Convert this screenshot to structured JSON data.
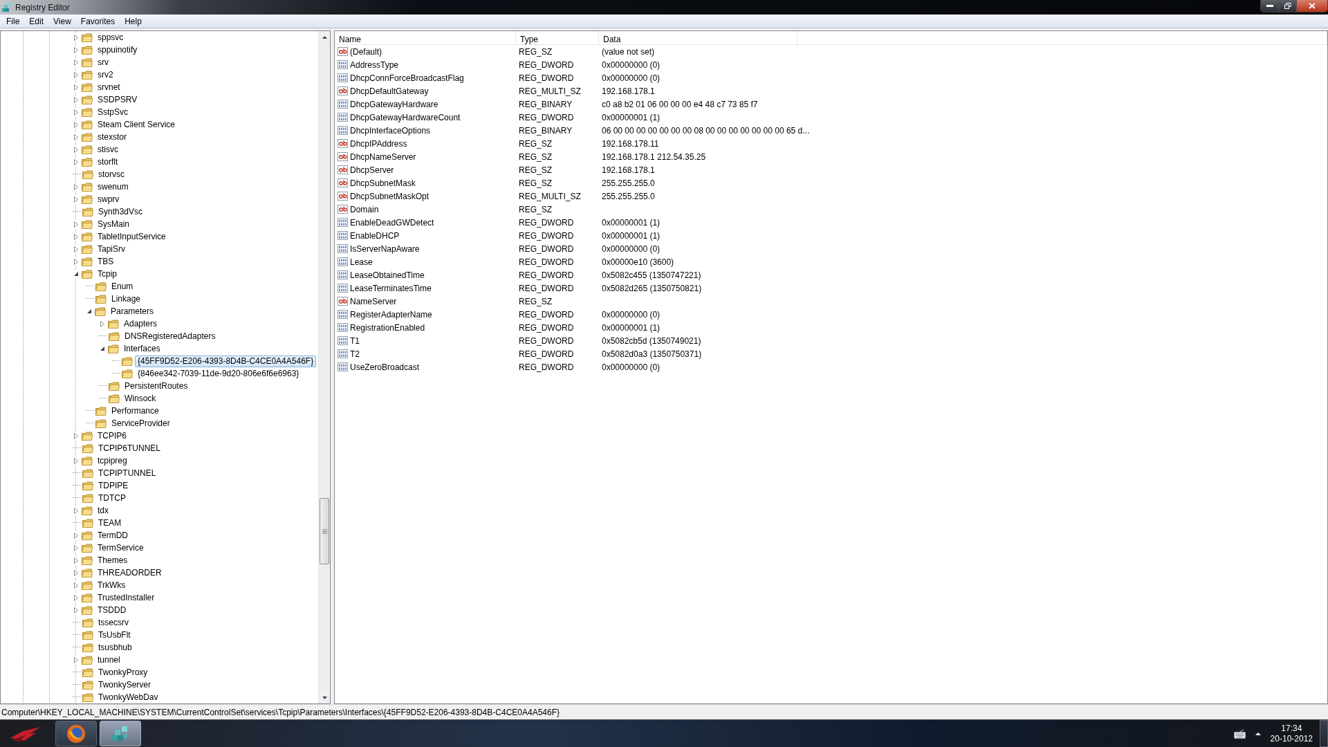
{
  "window": {
    "title": "Registry Editor"
  },
  "menu": [
    "File",
    "Edit",
    "View",
    "Favorites",
    "Help"
  ],
  "tree": [
    {
      "label": "sppsvc",
      "expandable": true,
      "expanded": false,
      "selected": false
    },
    {
      "label": "sppuinotify",
      "expandable": true,
      "expanded": false,
      "selected": false
    },
    {
      "label": "srv",
      "expandable": true,
      "expanded": false,
      "selected": false
    },
    {
      "label": "srv2",
      "expandable": true,
      "expanded": false,
      "selected": false
    },
    {
      "label": "srvnet",
      "expandable": true,
      "expanded": false,
      "selected": false
    },
    {
      "label": "SSDPSRV",
      "expandable": true,
      "expanded": false,
      "selected": false
    },
    {
      "label": "SstpSvc",
      "expandable": true,
      "expanded": false,
      "selected": false
    },
    {
      "label": "Steam Client Service",
      "expandable": true,
      "expanded": false,
      "selected": false
    },
    {
      "label": "stexstor",
      "expandable": true,
      "expanded": false,
      "selected": false
    },
    {
      "label": "stisvc",
      "expandable": true,
      "expanded": false,
      "selected": false
    },
    {
      "label": "storflt",
      "expandable": true,
      "expanded": false,
      "selected": false
    },
    {
      "label": "storvsc",
      "expandable": false,
      "selected": false
    },
    {
      "label": "swenum",
      "expandable": true,
      "expanded": false,
      "selected": false
    },
    {
      "label": "swprv",
      "expandable": true,
      "expanded": false,
      "selected": false
    },
    {
      "label": "Synth3dVsc",
      "expandable": false,
      "selected": false
    },
    {
      "label": "SysMain",
      "expandable": true,
      "expanded": false,
      "selected": false
    },
    {
      "label": "TabletInputService",
      "expandable": true,
      "expanded": false,
      "selected": false
    },
    {
      "label": "TapiSrv",
      "expandable": true,
      "expanded": false,
      "selected": false
    },
    {
      "label": "TBS",
      "expandable": true,
      "expanded": false,
      "selected": false
    },
    {
      "label": "Tcpip",
      "expandable": true,
      "expanded": true,
      "selected": false,
      "children": [
        {
          "label": "Enum",
          "expandable": false,
          "selected": false
        },
        {
          "label": "Linkage",
          "expandable": false,
          "selected": false
        },
        {
          "label": "Parameters",
          "expandable": true,
          "expanded": true,
          "selected": false,
          "children": [
            {
              "label": "Adapters",
              "expandable": true,
              "expanded": false,
              "selected": false
            },
            {
              "label": "DNSRegisteredAdapters",
              "expandable": false,
              "selected": false
            },
            {
              "label": "Interfaces",
              "expandable": true,
              "expanded": true,
              "selected": false,
              "children": [
                {
                  "label": "{45FF9D52-E206-4393-8D4B-C4CE0A4A546F}",
                  "expandable": false,
                  "selected": true
                },
                {
                  "label": "{846ee342-7039-11de-9d20-806e6f6e6963}",
                  "expandable": false,
                  "selected": false
                }
              ]
            },
            {
              "label": "PersistentRoutes",
              "expandable": false,
              "selected": false
            },
            {
              "label": "Winsock",
              "expandable": false,
              "selected": false
            }
          ]
        },
        {
          "label": "Performance",
          "expandable": false,
          "selected": false
        },
        {
          "label": "ServiceProvider",
          "expandable": false,
          "selected": false
        }
      ]
    },
    {
      "label": "TCPIP6",
      "expandable": true,
      "expanded": false,
      "selected": false
    },
    {
      "label": "TCPIP6TUNNEL",
      "expandable": false,
      "selected": false
    },
    {
      "label": "tcpipreg",
      "expandable": true,
      "expanded": false,
      "selected": false
    },
    {
      "label": "TCPIPTUNNEL",
      "expandable": false,
      "selected": false
    },
    {
      "label": "TDPIPE",
      "expandable": false,
      "selected": false
    },
    {
      "label": "TDTCP",
      "expandable": false,
      "selected": false
    },
    {
      "label": "tdx",
      "expandable": true,
      "expanded": false,
      "selected": false
    },
    {
      "label": "TEAM",
      "expandable": false,
      "selected": false
    },
    {
      "label": "TermDD",
      "expandable": true,
      "expanded": false,
      "selected": false
    },
    {
      "label": "TermService",
      "expandable": true,
      "expanded": false,
      "selected": false
    },
    {
      "label": "Themes",
      "expandable": true,
      "expanded": false,
      "selected": false
    },
    {
      "label": "THREADORDER",
      "expandable": true,
      "expanded": false,
      "selected": false
    },
    {
      "label": "TrkWks",
      "expandable": true,
      "expanded": false,
      "selected": false
    },
    {
      "label": "TrustedInstaller",
      "expandable": true,
      "expanded": false,
      "selected": false
    },
    {
      "label": "TSDDD",
      "expandable": true,
      "expanded": false,
      "selected": false
    },
    {
      "label": "tssecsrv",
      "expandable": false,
      "selected": false
    },
    {
      "label": "TsUsbFlt",
      "expandable": false,
      "selected": false
    },
    {
      "label": "tsusbhub",
      "expandable": false,
      "selected": false
    },
    {
      "label": "tunnel",
      "expandable": true,
      "expanded": false,
      "selected": false
    },
    {
      "label": "TwonkyProxy",
      "expandable": false,
      "selected": false
    },
    {
      "label": "TwonkyServer",
      "expandable": false,
      "selected": false
    },
    {
      "label": "TwonkyWebDav",
      "expandable": false,
      "selected": false
    }
  ],
  "values": {
    "columns": [
      "Name",
      "Type",
      "Data"
    ],
    "rows": [
      {
        "kind": "string",
        "name": "(Default)",
        "type": "REG_SZ",
        "data": "(value not set)"
      },
      {
        "kind": "binary",
        "name": "AddressType",
        "type": "REG_DWORD",
        "data": "0x00000000 (0)"
      },
      {
        "kind": "binary",
        "name": "DhcpConnForceBroadcastFlag",
        "type": "REG_DWORD",
        "data": "0x00000000 (0)"
      },
      {
        "kind": "string",
        "name": "DhcpDefaultGateway",
        "type": "REG_MULTI_SZ",
        "data": "192.168.178.1"
      },
      {
        "kind": "binary",
        "name": "DhcpGatewayHardware",
        "type": "REG_BINARY",
        "data": "c0 a8 b2 01 06 00 00 00 e4 48 c7 73 85 f7"
      },
      {
        "kind": "binary",
        "name": "DhcpGatewayHardwareCount",
        "type": "REG_DWORD",
        "data": "0x00000001 (1)"
      },
      {
        "kind": "binary",
        "name": "DhcpInterfaceOptions",
        "type": "REG_BINARY",
        "data": "06 00 00 00 00 00 00 00 08 00 00 00 00 00 00 00 65 d..."
      },
      {
        "kind": "string",
        "name": "DhcpIPAddress",
        "type": "REG_SZ",
        "data": "192.168.178.11"
      },
      {
        "kind": "string",
        "name": "DhcpNameServer",
        "type": "REG_SZ",
        "data": "192.168.178.1 212.54.35.25"
      },
      {
        "kind": "string",
        "name": "DhcpServer",
        "type": "REG_SZ",
        "data": "192.168.178.1"
      },
      {
        "kind": "string",
        "name": "DhcpSubnetMask",
        "type": "REG_SZ",
        "data": "255.255.255.0"
      },
      {
        "kind": "string",
        "name": "DhcpSubnetMaskOpt",
        "type": "REG_MULTI_SZ",
        "data": "255.255.255.0"
      },
      {
        "kind": "string",
        "name": "Domain",
        "type": "REG_SZ"
      },
      {
        "kind": "binary",
        "name": "EnableDeadGWDetect",
        "type": "REG_DWORD",
        "data": "0x00000001 (1)"
      },
      {
        "kind": "binary",
        "name": "EnableDHCP",
        "type": "REG_DWORD",
        "data": "0x00000001 (1)"
      },
      {
        "kind": "binary",
        "name": "IsServerNapAware",
        "type": "REG_DWORD",
        "data": "0x00000000 (0)"
      },
      {
        "kind": "binary",
        "name": "Lease",
        "type": "REG_DWORD",
        "data": "0x00000e10 (3600)"
      },
      {
        "kind": "binary",
        "name": "LeaseObtainedTime",
        "type": "REG_DWORD",
        "data": "0x5082c455 (1350747221)"
      },
      {
        "kind": "binary",
        "name": "LeaseTerminatesTime",
        "type": "REG_DWORD",
        "data": "0x5082d265 (1350750821)"
      },
      {
        "kind": "string",
        "name": "NameServer",
        "type": "REG_SZ"
      },
      {
        "kind": "binary",
        "name": "RegisterAdapterName",
        "type": "REG_DWORD",
        "data": "0x00000000 (0)"
      },
      {
        "kind": "binary",
        "name": "RegistrationEnabled",
        "type": "REG_DWORD",
        "data": "0x00000001 (1)"
      },
      {
        "kind": "binary",
        "name": "T1",
        "type": "REG_DWORD",
        "data": "0x5082cb5d (1350749021)"
      },
      {
        "kind": "binary",
        "name": "T2",
        "type": "REG_DWORD",
        "data": "0x5082d0a3 (1350750371)"
      },
      {
        "kind": "binary",
        "name": "UseZeroBroadcast",
        "type": "REG_DWORD",
        "data": "0x00000000 (0)"
      }
    ]
  },
  "status_bar": "Computer\\HKEY_LOCAL_MACHINE\\SYSTEM\\CurrentControlSet\\services\\Tcpip\\Parameters\\Interfaces\\{45FF9D52-E206-4393-8D4B-C4CE0A4A546F}",
  "taskbar": {
    "buttons": [
      {
        "kind": "start",
        "selected": false
      },
      {
        "kind": "browser",
        "selected": false
      },
      {
        "kind": "registry",
        "selected": true
      }
    ],
    "clock": {
      "time": "17:34",
      "date": "20-10-2012"
    }
  }
}
